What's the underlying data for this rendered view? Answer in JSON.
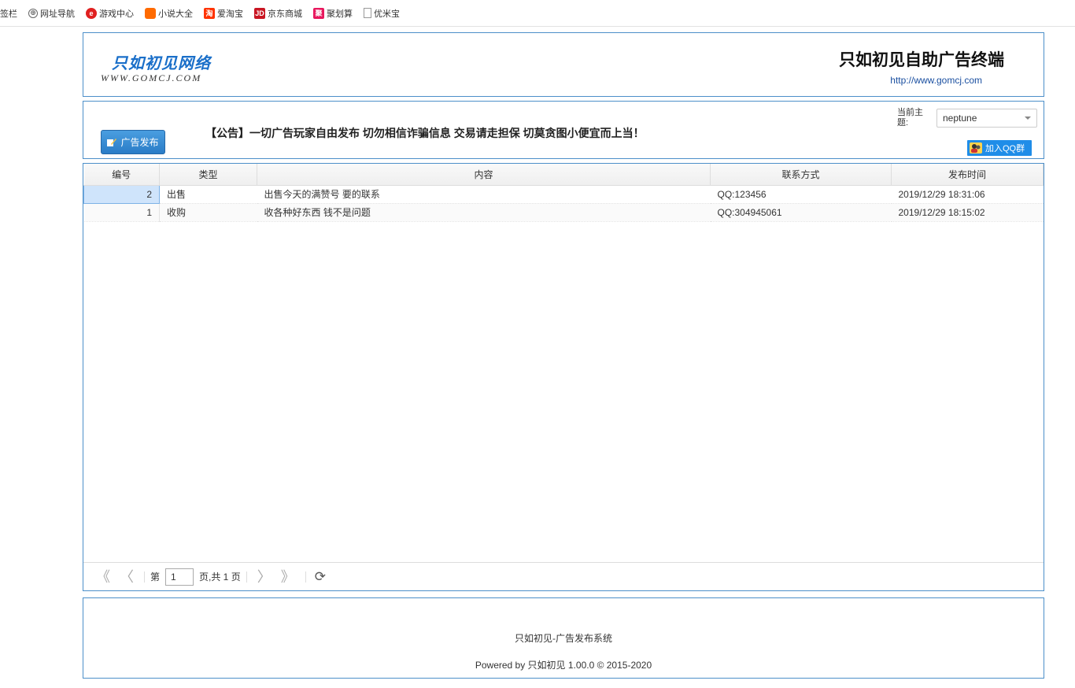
{
  "bookmarks": [
    {
      "label": "签栏",
      "icon": "none"
    },
    {
      "label": "网址导航",
      "icon": "globe-icon"
    },
    {
      "label": "游戏中心",
      "icon": "game-icon"
    },
    {
      "label": "小说大全",
      "icon": "novel-icon"
    },
    {
      "label": "爱淘宝",
      "icon": "taobao-icon"
    },
    {
      "label": "京东商城",
      "icon": "jd-icon"
    },
    {
      "label": "聚划算",
      "icon": "ju-icon"
    },
    {
      "label": "优米宝",
      "icon": "page-icon"
    }
  ],
  "bookmark_icon_text": {
    "taobao": "淘",
    "jd": "JD",
    "ju": "聚"
  },
  "header": {
    "logo_main": "只如初见网络",
    "logo_sub": "WWW.GOMCJ.COM",
    "site_title": "只如初见自助广告终端",
    "site_url": "http://www.gomcj.com"
  },
  "toolbar": {
    "publish_label": "广告发布",
    "notice": "【公告】一切广告玩家自由发布 切勿相信诈骗信息 交易请走担保 切莫贪图小便宜而上当！",
    "theme_label": "当前主题:",
    "theme_value": "neptune",
    "qq_label": "加入QQ群"
  },
  "grid": {
    "columns": [
      "编号",
      "类型",
      "内容",
      "联系方式",
      "发布时间"
    ],
    "rows": [
      {
        "id": "2",
        "type": "出售",
        "content": "出售今天的满赞号 要的联系",
        "contact": "QQ:123456",
        "time": "2019/12/29 18:31:06",
        "selected": true
      },
      {
        "id": "1",
        "type": "收购",
        "content": "收各种好东西 钱不是问题",
        "contact": "QQ:304945061",
        "time": "2019/12/29 18:15:02",
        "selected": false
      }
    ]
  },
  "pager": {
    "prefix": "第",
    "page": "1",
    "suffix": "页,共 1 页"
  },
  "footer": {
    "line1": "只如初见-广告发布系统",
    "line2": "Powered  by  只如初见  1.00.0  ©  2015-2020"
  },
  "colors": {
    "accent": "#4c8fc9",
    "button": "#2a7cc7",
    "qq": "#1f8de8",
    "selected_row": "#cfe4fb"
  }
}
